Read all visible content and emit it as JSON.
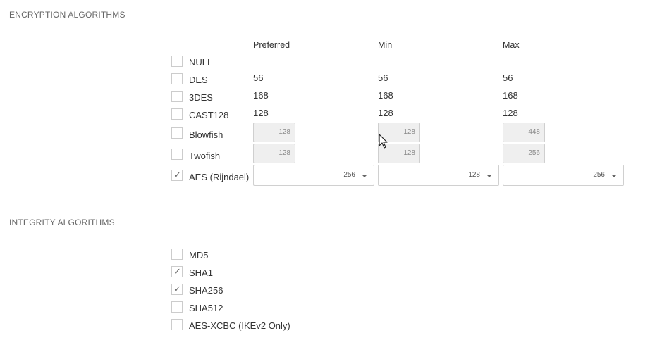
{
  "encryption": {
    "title": "ENCRYPTION ALGORITHMS",
    "headers": {
      "preferred": "Preferred",
      "min": "Min",
      "max": "Max"
    },
    "rows": [
      {
        "label": "NULL",
        "checked": false,
        "kind": "none"
      },
      {
        "label": "DES",
        "checked": false,
        "kind": "text",
        "preferred": "56",
        "min": "56",
        "max": "56"
      },
      {
        "label": "3DES",
        "checked": false,
        "kind": "text",
        "preferred": "168",
        "min": "168",
        "max": "168"
      },
      {
        "label": "CAST128",
        "checked": false,
        "kind": "text",
        "preferred": "128",
        "min": "128",
        "max": "128"
      },
      {
        "label": "Blowfish",
        "checked": false,
        "kind": "input",
        "preferred": "128",
        "min": "128",
        "max": "448"
      },
      {
        "label": "Twofish",
        "checked": false,
        "kind": "input",
        "preferred": "128",
        "min": "128",
        "max": "256"
      },
      {
        "label": "AES (Rijndael)",
        "checked": true,
        "kind": "select",
        "preferred": "256",
        "min": "128",
        "max": "256"
      }
    ]
  },
  "integrity": {
    "title": "INTEGRITY ALGORITHMS",
    "rows": [
      {
        "label": "MD5",
        "checked": false
      },
      {
        "label": "SHA1",
        "checked": true
      },
      {
        "label": "SHA256",
        "checked": true
      },
      {
        "label": "SHA512",
        "checked": false
      },
      {
        "label": "AES-XCBC (IKEv2 Only)",
        "checked": false
      }
    ]
  },
  "icons": {
    "check": "check-icon",
    "dropdown": "chevron-down-icon",
    "cursor": "mouse-pointer-icon"
  },
  "colors": {
    "border": "#cccccc",
    "disabled_bg": "#efefef",
    "text": "#333333",
    "section_title": "#666666"
  }
}
